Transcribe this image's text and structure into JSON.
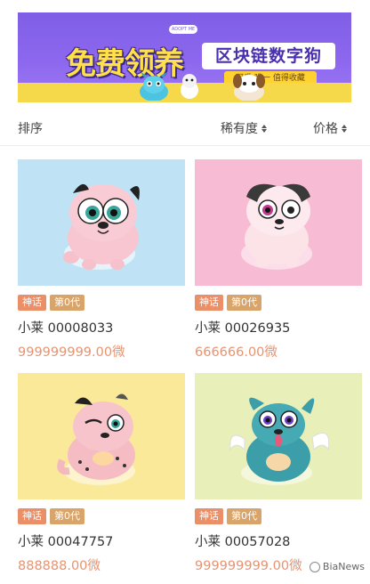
{
  "banner": {
    "headline": "免费领养",
    "subhead": "区块链数字狗",
    "ribbon_text": "可爱 唯一 值得收藏",
    "bone_text": "ADOPT ME"
  },
  "sort": {
    "label": "排序",
    "options": [
      {
        "label": "稀有度"
      },
      {
        "label": "价格"
      }
    ]
  },
  "colors": {
    "rare_badge": "#ea8f68",
    "generation_badge": "#d9a46a",
    "price_text": "#e99370"
  },
  "cards": [
    {
      "rarity": "神话",
      "generation": "第0代",
      "name": "小莱 00008033",
      "price": "999999999.00微",
      "bg": "#bfe3f5"
    },
    {
      "rarity": "神话",
      "generation": "第0代",
      "name": "小莱 00026935",
      "price": "666666.00微",
      "bg": "#f7bcd3"
    },
    {
      "rarity": "神话",
      "generation": "第0代",
      "name": "小莱 00047757",
      "price": "888888.00微",
      "bg": "#fbe99a"
    },
    {
      "rarity": "神话",
      "generation": "第0代",
      "name": "小莱 00057028",
      "price": "999999999.00微",
      "bg": "#e9efb9"
    }
  ],
  "watermark": "BiaNews"
}
